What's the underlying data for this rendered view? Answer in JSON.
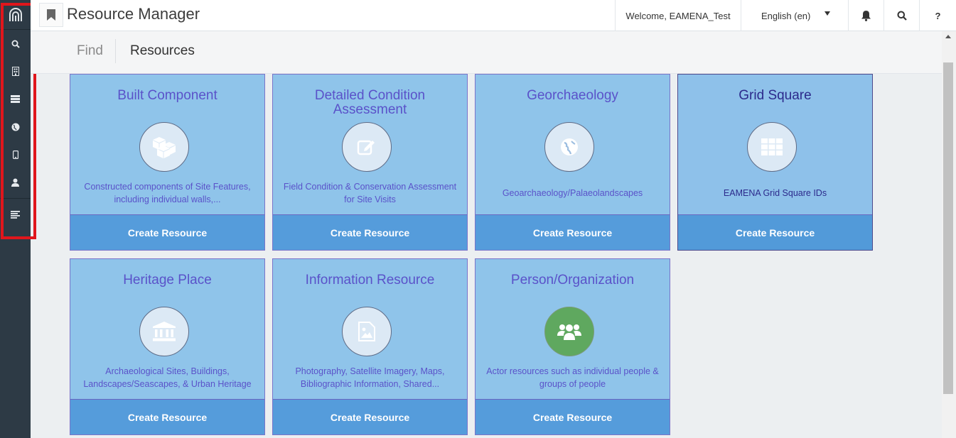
{
  "header": {
    "app_title": "Resource Manager",
    "welcome_text": "Welcome, EAMENA_Test",
    "language": "English (en)",
    "help_label": "?"
  },
  "sidebar": {
    "items": [
      {
        "name": "search",
        "icon": "search-icon"
      },
      {
        "name": "reports",
        "icon": "building-icon"
      },
      {
        "name": "resources",
        "icon": "server-icon"
      },
      {
        "name": "map",
        "icon": "globe-icon"
      },
      {
        "name": "mobile",
        "icon": "mobile-icon"
      },
      {
        "name": "profile",
        "icon": "user-icon"
      },
      {
        "name": "menu",
        "icon": "align-left-icon"
      }
    ]
  },
  "subheader": {
    "tab_find": "Find",
    "tab_resources": "Resources"
  },
  "cards": [
    {
      "title": "Built Component",
      "description": "Constructed components of Site Features, including individual walls,...",
      "icon": "cubes-icon",
      "button": "Create Resource"
    },
    {
      "title": "Detailed Condition Assessment",
      "description": "Field Condition & Conservation Assessment for Site Visits",
      "icon": "edit-icon",
      "button": "Create Resource"
    },
    {
      "title": "Georchaeology",
      "description": "Geoarchaeology/Palaeolandscapes",
      "icon": "globe-icon",
      "button": "Create Resource"
    },
    {
      "title": "Grid Square",
      "description": "EAMENA Grid Square IDs",
      "icon": "grid-icon",
      "button": "Create Resource"
    },
    {
      "title": "Heritage Place",
      "description": "Archaeological Sites, Buildings, Landscapes/Seascapes, & Urban Heritage",
      "icon": "institution-icon",
      "button": "Create Resource"
    },
    {
      "title": "Information Resource",
      "description": "Photography, Satellite Imagery, Maps, Bibliographic Information, Shared...",
      "icon": "image-icon",
      "button": "Create Resource"
    },
    {
      "title": "Person/Organization",
      "description": "Actor resources such as individual people & groups of people",
      "icon": "users-icon",
      "button": "Create Resource"
    }
  ],
  "colors": {
    "sidebar": "#2d3a45",
    "card_bg": "#8fc4ea",
    "button_bg": "#559cdb",
    "title_text": "#5a52c9",
    "highlight": "#e0161c",
    "person_icon_bg": "#5fa85f"
  }
}
